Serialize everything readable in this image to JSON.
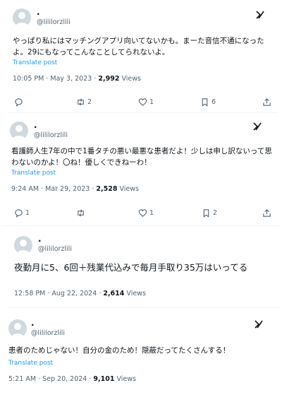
{
  "tweets": [
    {
      "display_name": ".",
      "handle": "@lililorzlili",
      "text": "やっぱり私にはマッチングアプリ向いてないかも。まーた音信不通になったよ。29にもなってこんなことしてられないよ。",
      "translate": "Translate post",
      "time": "10:05 PM · May 3, 2023 · ",
      "views": "2,992",
      "views_label": " Views",
      "retweets": "2",
      "likes": "1",
      "bookmarks": "6"
    },
    {
      "display_name": ".",
      "handle": "@lililorzlili",
      "text": "看護師人生7年の中で1番タチの悪い最悪な患者だよ！少しは申し訳ないって思わないのかよ！〇ね！優しくできねーわ！",
      "translate": "Translate post",
      "time": "9:24 AM · Mar 29, 2023 · ",
      "views": "2,528",
      "views_label": " Views",
      "replies": "1",
      "likes": "1",
      "bookmarks": "2"
    },
    {
      "display_name": ".",
      "handle": "@lililorzlili",
      "text": "夜勤月に5、6回＋残業代込みで毎月手取り35万はいってる",
      "time": "12:58 PM · Aug 22, 2024 · ",
      "views": "2,614",
      "views_label": " Views"
    },
    {
      "display_name": ".",
      "handle": "@lililorzlili",
      "text": "患者のためじゃない！自分の金のため！隠蔽だってたくさんする！",
      "translate": "Translate post",
      "time": "5:21 AM · Sep 20, 2024 · ",
      "views": "9,101",
      "views_label": " Views"
    }
  ]
}
